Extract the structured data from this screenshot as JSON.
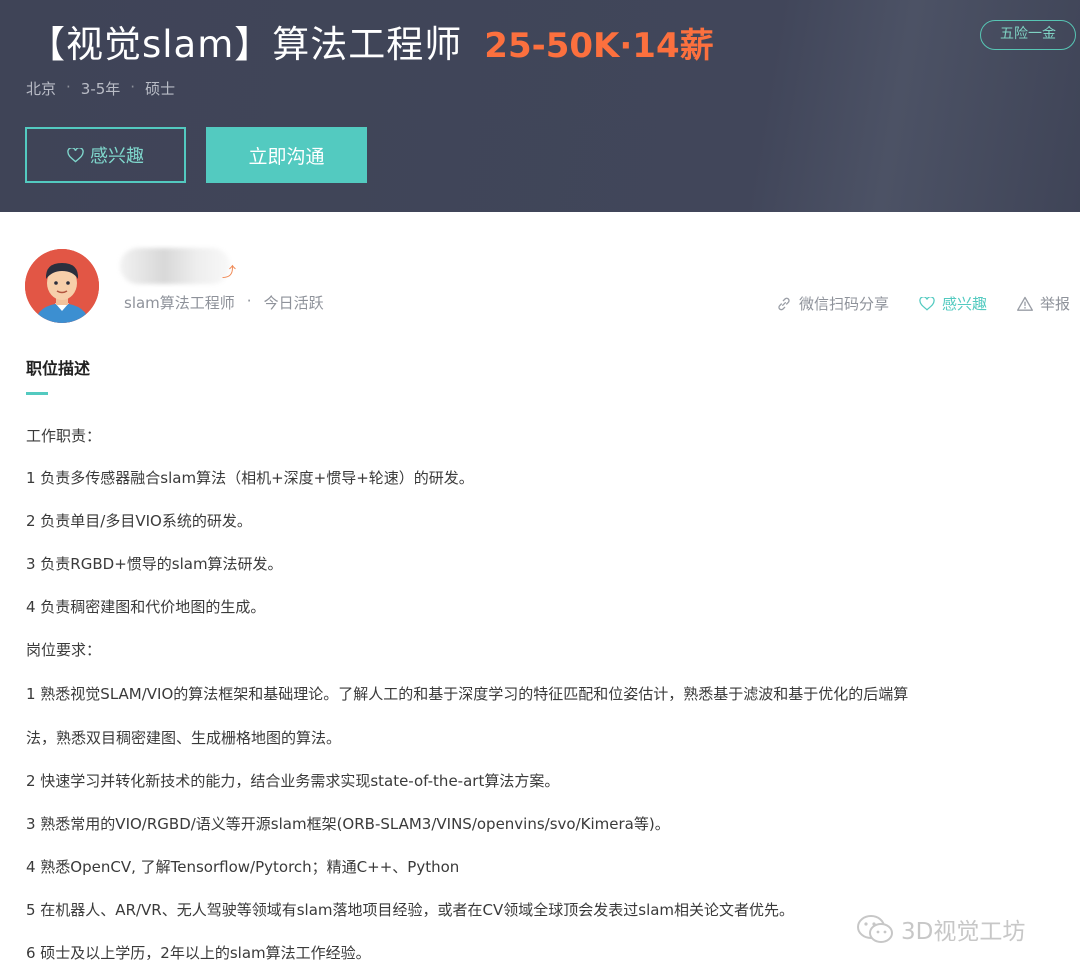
{
  "header": {
    "job_title": "【视觉slam】算法工程师",
    "salary": "25-50K·14薪",
    "benefit_tag": "五险一金",
    "location": "北京",
    "experience": "3-5年",
    "education": "硕士",
    "meta_separator": "·",
    "interest_button": "感兴趣",
    "chat_button": "立即沟通"
  },
  "recruiter": {
    "role": "slam算法工程师",
    "separator": "·",
    "activity": "今日活跃"
  },
  "actions": {
    "share": "微信扫码分享",
    "interest": "感兴趣",
    "report": "举报"
  },
  "section": {
    "title": "职位描述",
    "lines": [
      "工作职责：",
      "1 负责多传感器融合slam算法（相机+深度+惯导+轮速）的研发。",
      "2 负责单目/多目VIO系统的研发。",
      "3 负责RGBD+惯导的slam算法研发。",
      "4 负责稠密建图和代价地图的生成。",
      "岗位要求：",
      "1 熟悉视觉SLAM/VIO的算法框架和基础理论。了解人工的和基于深度学习的特征匹配和位姿估计，熟悉基于滤波和基于优化的后端算",
      "法，熟悉双目稠密建图、生成栅格地图的算法。",
      "2 快速学习并转化新技术的能力，结合业务需求实现state-of-the-art算法方案。",
      "3 熟悉常用的VIO/RGBD/语义等开源slam框架(ORB-SLAM3/VINS/openvins/svo/Kimera等)。",
      "4 熟悉OpenCV, 了解Tensorflow/Pytorch；精通C++、Python",
      "5 在机器人、AR/VR、无人驾驶等领域有slam落地项目经验，或者在CV领域全球顶会发表过slam相关论文者优先。",
      "6 硕士及以上学历，2年以上的slam算法工作经验。"
    ]
  },
  "watermark": "3D视觉工坊",
  "colors": {
    "header_bg": "#41465a",
    "accent_teal": "#53cac0",
    "salary_orange": "#fc703e"
  }
}
